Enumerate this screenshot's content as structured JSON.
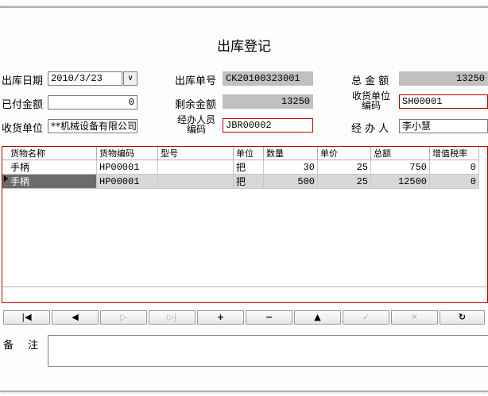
{
  "form": {
    "title": "出库登记",
    "labels": {
      "date": "出库日期",
      "order_no": "出库单号",
      "total": "总 金 额",
      "paid": "已付金额",
      "remaining": "剩余金额",
      "receiver_code_line1": "收货单位",
      "receiver_code_line2": "编码",
      "receiver": "收货单位",
      "handler_code_line1": "经办人员",
      "handler_code_line2": "编码",
      "handler": "经 办 人",
      "memo": "备注"
    },
    "values": {
      "date": "2010/3/23",
      "order_no": "CK20100323001",
      "total": "13250",
      "paid": "0",
      "remaining": "13250",
      "receiver_code": "SH00001",
      "receiver": "**机械设备有限公司",
      "handler_code": "JBR00002",
      "handler": "李小慧",
      "memo": ""
    }
  },
  "grid": {
    "columns": [
      "货物名称",
      "货物编码",
      "型号",
      "单位",
      "数量",
      "单价",
      "总额",
      "增值税率"
    ],
    "rows": [
      {
        "name": "手柄",
        "code": "HP00001",
        "model": "",
        "unit": "把",
        "qty": "30",
        "price": "25",
        "amount": "750",
        "tax": "0"
      },
      {
        "name": "手柄",
        "code": "HP00001",
        "model": "",
        "unit": "把",
        "qty": "500",
        "price": "25",
        "amount": "12500",
        "tax": "0"
      }
    ]
  },
  "nav_buttons": [
    {
      "name": "first-record-button",
      "glyph": "|◀",
      "enabled": true
    },
    {
      "name": "prev-record-button",
      "glyph": "◀",
      "enabled": true
    },
    {
      "name": "next-record-button",
      "glyph": "▷",
      "enabled": false
    },
    {
      "name": "last-record-button",
      "glyph": "▷|",
      "enabled": false
    },
    {
      "name": "add-record-button",
      "glyph": "+",
      "enabled": true
    },
    {
      "name": "delete-record-button",
      "glyph": "−",
      "enabled": true
    },
    {
      "name": "edit-record-button",
      "glyph": "▲",
      "enabled": true
    },
    {
      "name": "post-record-button",
      "glyph": "✓",
      "enabled": false
    },
    {
      "name": "cancel-record-button",
      "glyph": "✕",
      "enabled": false
    },
    {
      "name": "refresh-button",
      "glyph": "↻",
      "enabled": true
    }
  ],
  "colors": {
    "required_border": "#c00000",
    "readonly_fill": "#c0c0c0",
    "selected_cell": "#6b6b6b"
  }
}
